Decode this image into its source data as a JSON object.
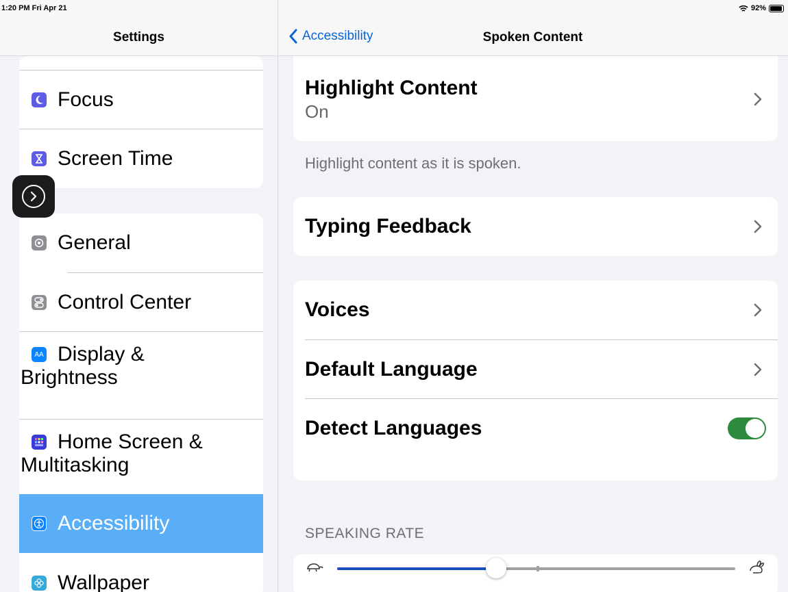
{
  "status": {
    "time": "1:20 PM  Fri Apr 21",
    "battery": "92%",
    "battery_level": 0.92
  },
  "sidebar": {
    "title": "Settings",
    "groups": [
      [
        {
          "label": "Focus",
          "icon": "moon-icon",
          "color": "#5e5ce6"
        },
        {
          "label": "Screen Time",
          "icon": "hourglass-icon",
          "color": "#5e5ce6"
        }
      ],
      [
        {
          "label": "General",
          "icon": "gear-icon",
          "color": "#8e8e93"
        },
        {
          "label": "Control Center",
          "icon": "switches-icon",
          "color": "#8e8e93"
        },
        {
          "label": "Display &",
          "label2": "Brightness",
          "icon": "text-size-icon",
          "color": "#0a84ff"
        },
        {
          "label": "Home Screen &",
          "label2": "Multitasking",
          "icon": "grid-icon",
          "color": "#3a3ad6"
        },
        {
          "label": "Accessibility",
          "icon": "accessibility-icon",
          "color": "#0a84ff",
          "selected": true
        },
        {
          "label": "Wallpaper",
          "icon": "flower-icon",
          "color": "#35aadc"
        }
      ]
    ]
  },
  "nav": {
    "back_label": "Accessibility",
    "title": "Spoken Content"
  },
  "detail": {
    "highlight": {
      "label": "Highlight Content",
      "value": "On"
    },
    "highlight_footnote": "Highlight content as it is spoken.",
    "typing_feedback": "Typing Feedback",
    "voices": "Voices",
    "default_language": "Default Language",
    "detect_languages": "Detect Languages",
    "detect_languages_on": true,
    "speaking_rate_header": "SPEAKING RATE",
    "speaking_rate": 0.4
  },
  "colors": {
    "accent": "#0a64d6",
    "toggle_on": "#2e8b3d",
    "selected_row": "#5aaef7"
  }
}
